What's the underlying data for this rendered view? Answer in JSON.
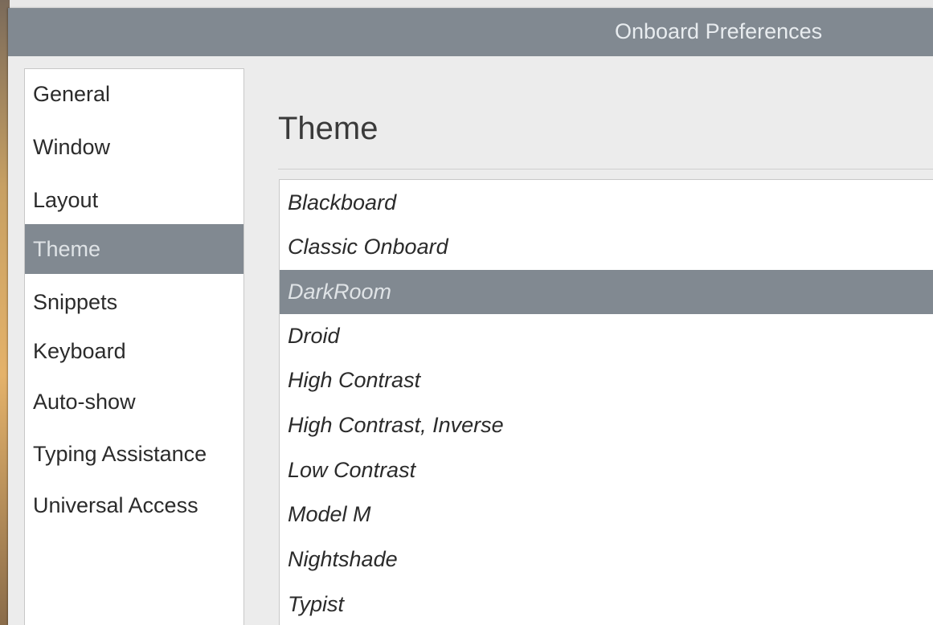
{
  "window": {
    "title": "Onboard Preferences"
  },
  "sidebar": {
    "items": [
      {
        "label": "General",
        "selected": false
      },
      {
        "label": "Window",
        "selected": false
      },
      {
        "label": "Layout",
        "selected": false
      },
      {
        "label": "Theme",
        "selected": true
      },
      {
        "label": "Snippets",
        "selected": false
      },
      {
        "label": "Keyboard",
        "selected": false
      },
      {
        "label": "Auto-show",
        "selected": false
      },
      {
        "label": "Typing Assistance",
        "selected": false
      },
      {
        "label": "Universal Access",
        "selected": false
      }
    ]
  },
  "main": {
    "heading": "Theme",
    "themes": [
      {
        "label": "Blackboard",
        "selected": false
      },
      {
        "label": "Classic Onboard",
        "selected": false
      },
      {
        "label": "DarkRoom",
        "selected": true
      },
      {
        "label": "Droid",
        "selected": false
      },
      {
        "label": "High Contrast",
        "selected": false
      },
      {
        "label": "High Contrast, Inverse",
        "selected": false
      },
      {
        "label": "Low Contrast",
        "selected": false
      },
      {
        "label": "Model M",
        "selected": false
      },
      {
        "label": "Nightshade",
        "selected": false
      },
      {
        "label": "Typist",
        "selected": false
      }
    ]
  },
  "colors": {
    "titlebar": "#818991",
    "selection": "#818991",
    "selection_text": "#dfe3e6",
    "background": "#ececec"
  }
}
